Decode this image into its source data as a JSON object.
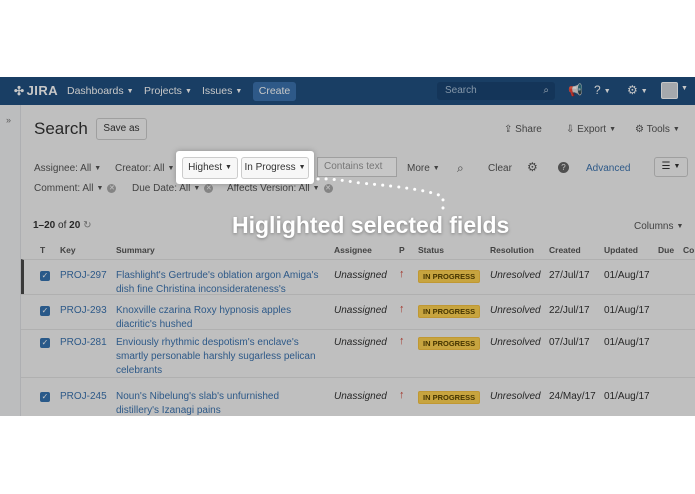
{
  "nav": {
    "logo": "JIRA",
    "dashboards": "Dashboards",
    "projects": "Projects",
    "issues": "Issues",
    "create": "Create",
    "search_placeholder": "Search",
    "search_icon": "magnifier-icon",
    "notifications_icon": "megaphone-icon",
    "help_icon": "help-icon",
    "settings_icon": "gear-icon",
    "brand_color": "#205081"
  },
  "header": {
    "title": "Search",
    "save_as": "Save as",
    "share": "Share",
    "export": "Export",
    "tools": "Tools"
  },
  "criteria": {
    "assignee": "Assignee: All",
    "creator": "Creator: All",
    "priority": "Highest",
    "status": "In Progress",
    "contains_placeholder": "Contains text",
    "more": "More",
    "clear": "Clear",
    "advanced": "Advanced",
    "comment": "Comment: All",
    "due_date": "Due Date: All",
    "affects_version": "Affects Version: All"
  },
  "results": {
    "count_prefix": "1–20",
    "count_of": "of",
    "count_total": "20",
    "columns": "Columns"
  },
  "table": {
    "headers": [
      "T",
      "Key",
      "Summary",
      "Assignee",
      "P",
      "Status",
      "Resolution",
      "Created",
      "Updated",
      "Due",
      "Co"
    ],
    "rows": [
      {
        "key": "PROJ-297",
        "summary": "Flashlight's Gertrude's oblation argon Amiga's dish fine Christina inconsiderateness's",
        "assignee": "Unassigned",
        "status": "IN PROGRESS",
        "resolution": "Unresolved",
        "created": "27/Jul/17",
        "updated": "01/Aug/17"
      },
      {
        "key": "PROJ-293",
        "summary": "Knoxville czarina Roxy hypnosis apples diacritic's hushed",
        "assignee": "Unassigned",
        "status": "IN PROGRESS",
        "resolution": "Unresolved",
        "created": "22/Jul/17",
        "updated": "01/Aug/17"
      },
      {
        "key": "PROJ-281",
        "summary": "Enviously rhythmic despotism's enclave's smartly personable harshly sugarless pelican celebrants",
        "assignee": "Unassigned",
        "status": "IN PROGRESS",
        "resolution": "Unresolved",
        "created": "07/Jul/17",
        "updated": "01/Aug/17"
      },
      {
        "key": "PROJ-245",
        "summary": "Noun's Nibelung's slab's unfurnished distillery's Izanagi pains",
        "assignee": "Unassigned",
        "status": "IN PROGRESS",
        "resolution": "Unresolved",
        "created": "24/May/17",
        "updated": "01/Aug/17"
      }
    ]
  },
  "callout": {
    "text": "Higlighted selected fields"
  }
}
